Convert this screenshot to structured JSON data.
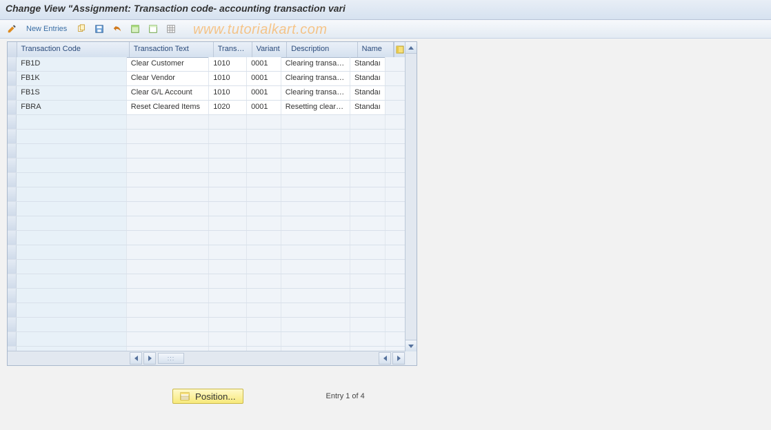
{
  "title": "Change View \"Assignment: Transaction code- accounting transaction vari",
  "watermark": "www.tutorialkart.com",
  "toolbar": {
    "new_entries": "New Entries"
  },
  "table": {
    "headers": {
      "c1": "Transaction Code",
      "c2": "Transaction Text",
      "c3": "Transac...",
      "c4": "Variant",
      "c5": "Description",
      "c6": "Name"
    },
    "rows": [
      {
        "c1": "FB1D",
        "c2": "Clear Customer",
        "c3": "1010",
        "c4": "0001",
        "c5": "Clearing transactio…",
        "c6": "Standaı"
      },
      {
        "c1": "FB1K",
        "c2": "Clear Vendor",
        "c3": "1010",
        "c4": "0001",
        "c5": "Clearing transactio…",
        "c6": "Standaı"
      },
      {
        "c1": "FB1S",
        "c2": "Clear G/L Account",
        "c3": "1010",
        "c4": "0001",
        "c5": "Clearing transactio…",
        "c6": "Standaı"
      },
      {
        "c1": "FBRA",
        "c2": "Reset Cleared Items",
        "c3": "1020",
        "c4": "0001",
        "c5": "Resetting cleared i…",
        "c6": "Standaı"
      }
    ]
  },
  "footer": {
    "position_button": "Position...",
    "entry_label": "Entry 1 of 4"
  }
}
